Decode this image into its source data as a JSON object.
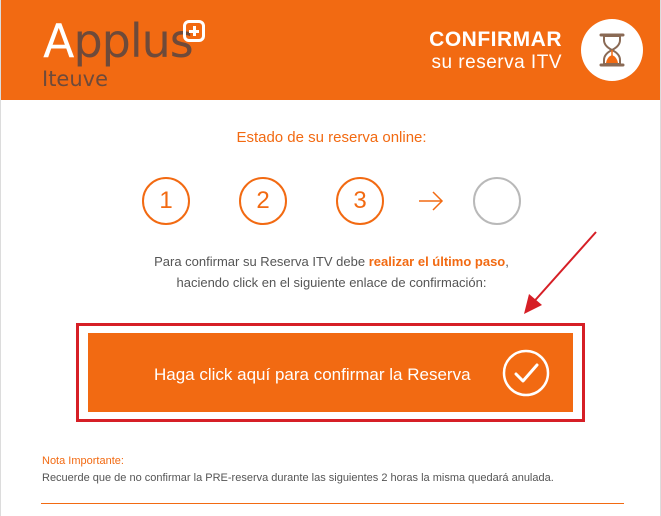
{
  "header": {
    "logo_main_a": "A",
    "logo_main_rest": "pplus",
    "logo_sub": "Iteuve",
    "title": "CONFIRMAR",
    "subtitle": "su reserva ITV",
    "icon": "hourglass-icon",
    "background_color": "#f26a12"
  },
  "status": {
    "title": "Estado de su reserva online:",
    "steps": [
      {
        "label": "1",
        "state": "done"
      },
      {
        "label": "2",
        "state": "done"
      },
      {
        "label": "3",
        "state": "done"
      },
      {
        "label": "",
        "state": "pending"
      }
    ],
    "arrow_icon": "arrow-right-icon"
  },
  "instruction": {
    "line1_before": "Para confirmar su Reserva ITV debe ",
    "line1_highlight": "realizar el último paso",
    "line1_after": ",",
    "line2": "haciendo click en el siguiente enlace de confirmación:"
  },
  "confirm": {
    "label": "Haga click aquí para confirmar la Reserva",
    "icon": "check-circle-icon",
    "outline_color": "#d61f26"
  },
  "note": {
    "title": "Nota Importante:",
    "text": "Recuerde que de no confirmar la PRE-reserva durante las siguientes 2 horas la misma quedará anulada."
  },
  "colors": {
    "accent": "#f26a12",
    "annotation_red": "#d61f26",
    "text_gray": "#555555"
  }
}
